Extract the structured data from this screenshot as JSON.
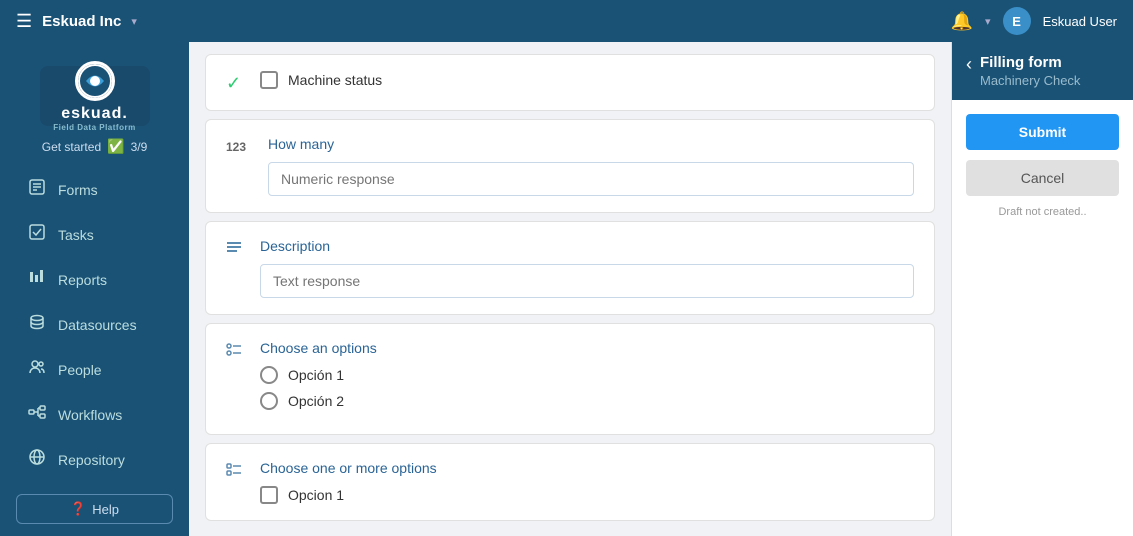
{
  "topbar": {
    "brand": "Eskuad Inc",
    "chevron": "▾",
    "username": "Eskuad User"
  },
  "sidebar": {
    "get_started": "Get started",
    "progress": "3/9",
    "nav_items": [
      {
        "id": "forms",
        "label": "Forms",
        "icon": "form"
      },
      {
        "id": "tasks",
        "label": "Tasks",
        "icon": "task"
      },
      {
        "id": "reports",
        "label": "Reports",
        "icon": "report"
      },
      {
        "id": "datasources",
        "label": "Datasources",
        "icon": "data"
      },
      {
        "id": "people",
        "label": "People",
        "icon": "people"
      },
      {
        "id": "workflows",
        "label": "Workflows",
        "icon": "workflow"
      },
      {
        "id": "repository",
        "label": "Repository",
        "icon": "repo"
      }
    ],
    "help_label": "Help"
  },
  "form": {
    "sections": [
      {
        "id": "machine-status",
        "type": "checkbox",
        "icon": "check",
        "label": "Machine status",
        "options": []
      },
      {
        "id": "how-many",
        "type": "numeric",
        "icon": "123",
        "label": "How many",
        "placeholder": "Numeric response"
      },
      {
        "id": "description",
        "type": "text",
        "icon": "lines",
        "label": "Description",
        "placeholder": "Text response"
      },
      {
        "id": "choose-options",
        "type": "radio",
        "icon": "list",
        "label": "Choose an options",
        "options": [
          "Opción 1",
          "Opción 2"
        ]
      },
      {
        "id": "choose-more",
        "type": "checkbox-multi",
        "icon": "list",
        "label": "Choose one or more options",
        "options": [
          "Opcion 1"
        ]
      }
    ]
  },
  "panel": {
    "title": "Filling form",
    "subtitle": "Machinery Check",
    "submit_label": "Submit",
    "cancel_label": "Cancel",
    "draft_text": "Draft not created.."
  }
}
